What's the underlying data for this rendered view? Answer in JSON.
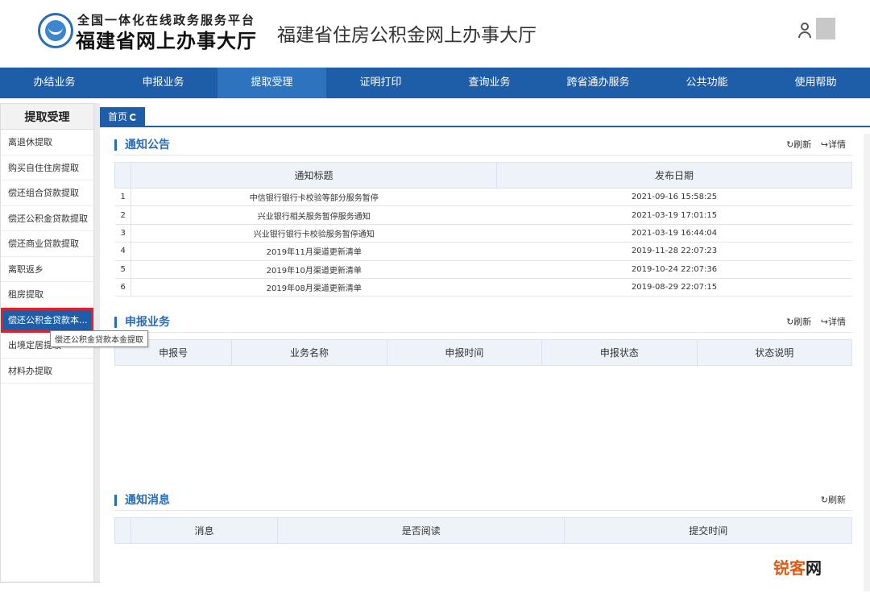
{
  "header": {
    "logo_line1": "全国一体化在线政务服务平台",
    "logo_line2": "福建省网上办事大厅",
    "site_title": "福建省住房公积金网上办事大厅"
  },
  "nav": {
    "items": [
      {
        "label": "办结业务"
      },
      {
        "label": "申报业务"
      },
      {
        "label": "提取受理"
      },
      {
        "label": "证明打印"
      },
      {
        "label": "查询业务"
      },
      {
        "label": "跨省通办服务"
      },
      {
        "label": "公共功能"
      },
      {
        "label": "使用帮助"
      }
    ],
    "active_index": 2
  },
  "sidebar": {
    "title": "提取受理",
    "items": [
      {
        "label": "离退休提取"
      },
      {
        "label": "购买自住住房提取"
      },
      {
        "label": "偿还组合贷款提取"
      },
      {
        "label": "偿还公积金贷款提取"
      },
      {
        "label": "偿还商业贷款提取"
      },
      {
        "label": "离职返乡"
      },
      {
        "label": "租房提取"
      },
      {
        "label": "偿还公积金贷款本..."
      },
      {
        "label": "出境定居提取"
      },
      {
        "label": "材料办提取"
      }
    ],
    "active_index": 7,
    "tooltip": "偿还公积金贷款本金提取"
  },
  "tabs": {
    "home_label": "首页"
  },
  "notices": {
    "title": "通知公告",
    "refresh_label": "刷新",
    "detail_label": "详情",
    "headers": [
      "通知标题",
      "发布日期"
    ],
    "rows": [
      {
        "idx": "1",
        "title": "中信银行银行卡校验等部分服务暂停",
        "date": "2021-09-16 15:58:25"
      },
      {
        "idx": "2",
        "title": "兴业银行相关服务暂停服务通知",
        "date": "2021-03-19 17:01:15"
      },
      {
        "idx": "3",
        "title": "兴业银行银行卡校验服务暂停通知",
        "date": "2021-03-19 16:44:04"
      },
      {
        "idx": "4",
        "title": "2019年11月渠道更新清单",
        "date": "2019-11-28 22:07:23"
      },
      {
        "idx": "5",
        "title": "2019年10月渠道更新清单",
        "date": "2019-10-24 22:07:36"
      },
      {
        "idx": "6",
        "title": "2019年08月渠道更新清单",
        "date": "2019-08-29 22:07:15"
      }
    ]
  },
  "declarations": {
    "title": "申报业务",
    "refresh_label": "刷新",
    "detail_label": "详情",
    "headers": [
      "申报号",
      "业务名称",
      "申报时间",
      "申报状态",
      "状态说明"
    ]
  },
  "messages": {
    "title": "通知消息",
    "refresh_label": "刷新",
    "headers": [
      "消息",
      "是否阅读",
      "提交时间"
    ]
  },
  "watermark": {
    "part1": "锐客",
    "part2": "网"
  },
  "colors": {
    "primary": "#1e5ea8",
    "accent": "#2a6db5",
    "highlight": "#e0212b"
  }
}
